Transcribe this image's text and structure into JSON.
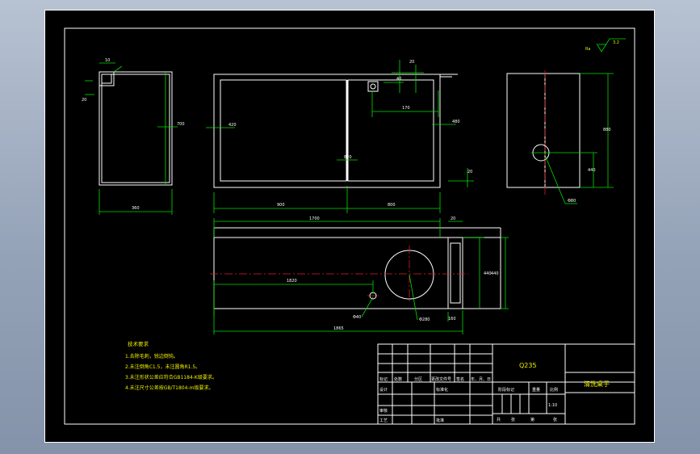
{
  "colors": {
    "background": "#000000",
    "outline": "#ffffff",
    "dimension": "#00e000",
    "centerline": "#e02020",
    "note_text": "#f0f000",
    "frame_outer": "#8d9aaf"
  },
  "roughness": {
    "label": "3.2",
    "prefix": "Ra"
  },
  "dims": {
    "side_width": "360",
    "side_height": "700",
    "side_top": "10",
    "side_left": "20",
    "front_w1": "900",
    "front_w2": "800",
    "front_h": "420",
    "front_h2": "820",
    "front_small_top": "20",
    "front_hole": "40",
    "front_hole_w": "170",
    "front_right_h": "480",
    "front_top": "20",
    "end_h": "880",
    "end_h2": "440",
    "end_hole": "Φ80",
    "top_len": "1700",
    "top_len2": "1820",
    "top_total": "1865",
    "top_w": "440",
    "top_w2": "440",
    "top_circle": "Φ280",
    "top_hole": "Φ40",
    "top_small": "20",
    "top_right": "160"
  },
  "notes": {
    "heading": "技术要求",
    "items": [
      "1.去除毛刺，锐边倒钝。",
      "2.未注倒角C1.5，未注圆角R1.5。",
      "3.未注形状公差应符合GB1184-K级要求。",
      "4.未注尺寸公差按GB/T1804-m级要求。"
    ]
  },
  "title_block": {
    "material": "Q235",
    "part_name": "清洗桌子",
    "scale": "1:10",
    "row_labels": {
      "mark": "标记",
      "count": "处数",
      "zone": "分区",
      "change_doc": "更改文件号",
      "sign": "签名",
      "date": "年、月、日",
      "design": "设计",
      "standard": "标准化",
      "stage_mark": "阶段标记",
      "weight": "重量",
      "scale_label": "比例",
      "check": "审核",
      "process": "工艺",
      "approve": "批准",
      "sheets": "共",
      "sheet": "张",
      "page": "第",
      "page_end": "张"
    }
  }
}
